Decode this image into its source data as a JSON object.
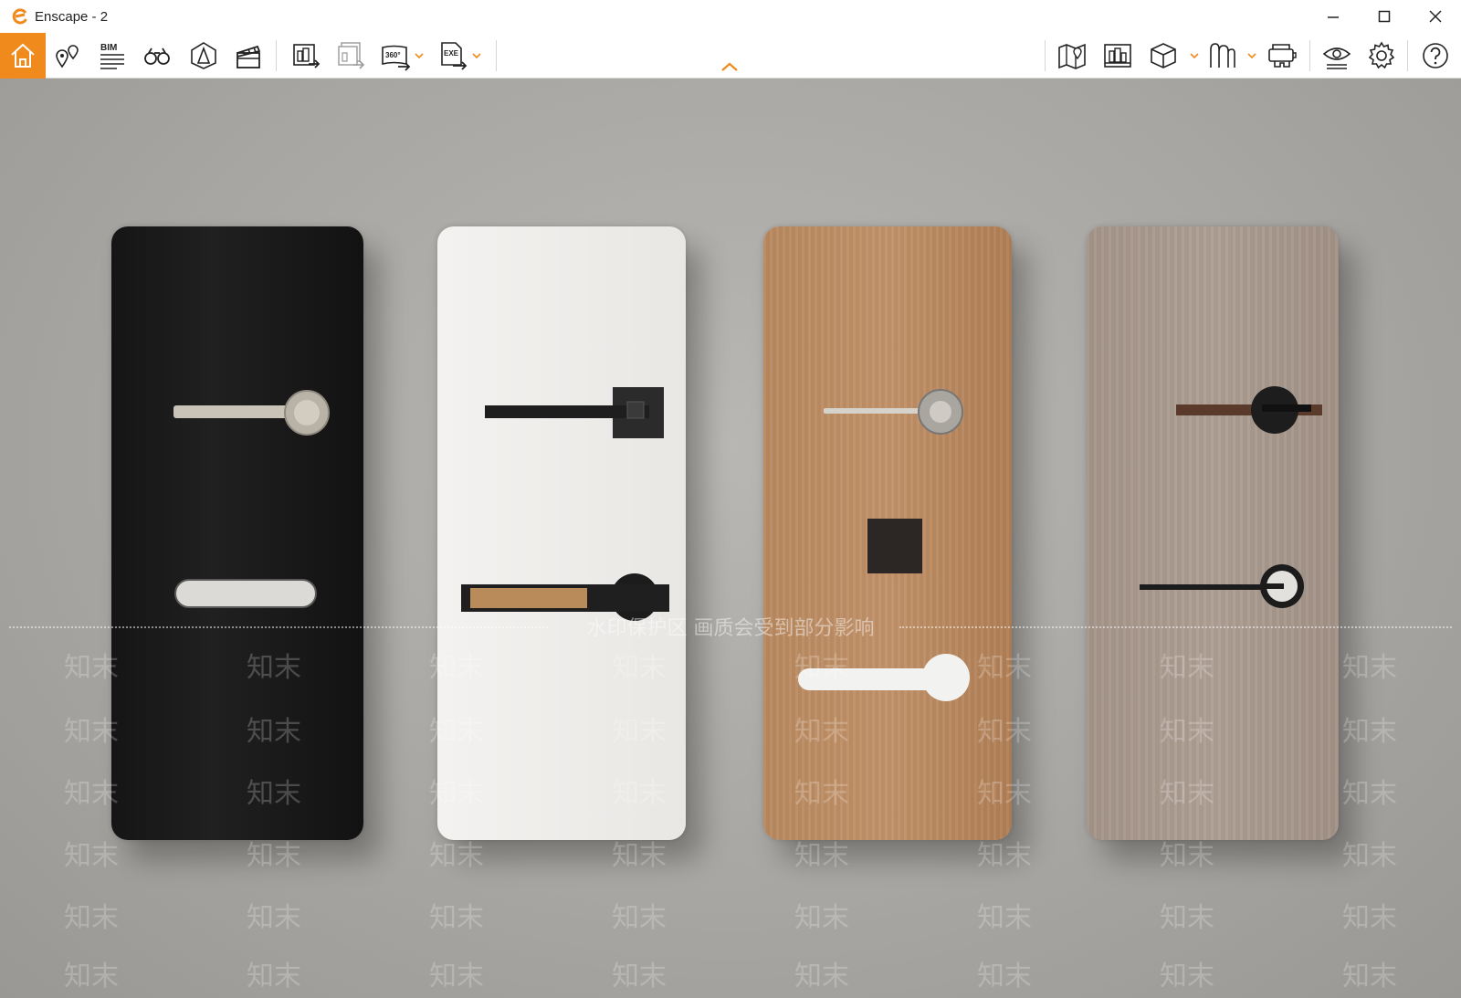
{
  "window": {
    "title": "Enscape - 2",
    "accent_color": "#f08a1c"
  },
  "toolbar": {
    "left_tools": [
      {
        "name": "home",
        "icon": "home-icon"
      },
      {
        "name": "views",
        "icon": "location-pins-icon"
      },
      {
        "name": "bim",
        "icon": "bim-list-icon",
        "label": "BIM"
      },
      {
        "name": "binoculars",
        "icon": "binoculars-icon"
      },
      {
        "name": "orthographic",
        "icon": "perspective-icon"
      },
      {
        "name": "video-editor",
        "icon": "clapperboard-icon"
      },
      {
        "name": "screenshot-export",
        "icon": "image-export-icon"
      },
      {
        "name": "batch-export",
        "icon": "batch-export-icon"
      },
      {
        "name": "panorama-export",
        "icon": "panorama-360-icon",
        "label": "360°"
      },
      {
        "name": "exe-export",
        "icon": "exe-export-icon",
        "label": "EXE"
      }
    ],
    "right_tools": [
      {
        "name": "map",
        "icon": "map-icon"
      },
      {
        "name": "asset-library",
        "icon": "asset-library-icon"
      },
      {
        "name": "upload-model",
        "icon": "cube-icon"
      },
      {
        "name": "material-editor",
        "icon": "material-icon"
      },
      {
        "name": "vr-headset",
        "icon": "vr-headset-icon"
      },
      {
        "name": "visual-settings",
        "icon": "eye-settings-icon"
      },
      {
        "name": "general-settings",
        "icon": "gear-icon"
      },
      {
        "name": "help",
        "icon": "help-icon"
      }
    ]
  },
  "viewport": {
    "watermark_center": "水印保护区   画质会受到部分影响",
    "watermark_repeat": "知末"
  }
}
